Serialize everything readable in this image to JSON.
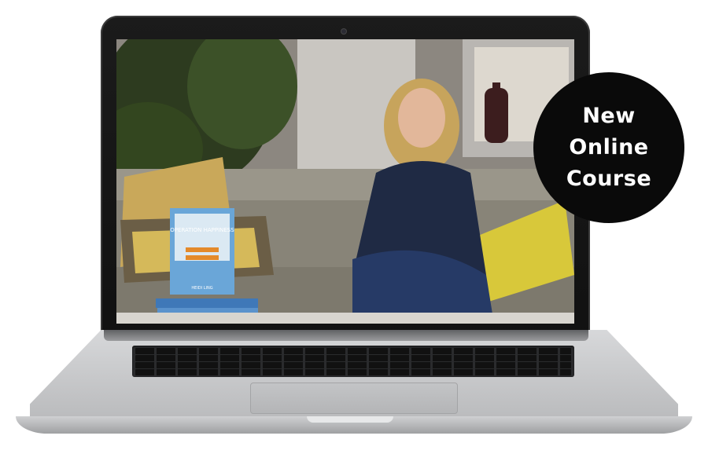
{
  "badge": {
    "line1": "New",
    "line2": "Online",
    "line3": "Course"
  },
  "book": {
    "title": "OPERATION HAPPINESS",
    "author": "HEIDI LING"
  },
  "colors": {
    "badge_bg": "#0a0a0a",
    "laptop_silver": "#c6c7c9",
    "screen_bezel": "#111111",
    "pillow_yellow": "#d8c83a",
    "book_blue": "#6aa6d8"
  },
  "icons": [
    "laptop-camera-icon"
  ]
}
